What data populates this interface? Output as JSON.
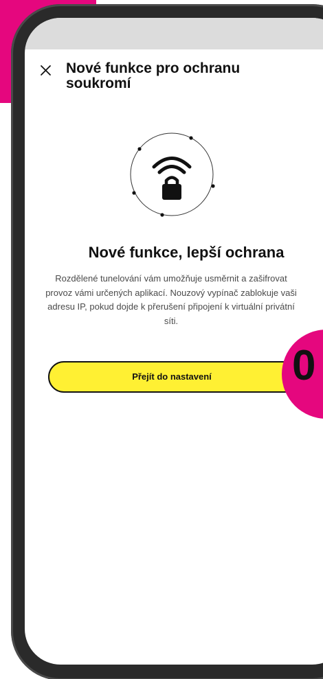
{
  "dialog": {
    "close_label": "×",
    "title": "Nové funkce pro ochranu soukromí"
  },
  "content": {
    "heading": "Nové funkce, lepší ochrana",
    "body": "Rozdělené tunelování vám umožňuje usměrnit a zašifrovat provoz vámi určených aplikací. Nouzový vypínač zablokuje vaši adresu IP, pokud dojde k přerušení připojení k virtuální privátní síti."
  },
  "actions": {
    "cta_label": "Přejít do nastavení"
  },
  "badge": {
    "text": "0"
  },
  "icons": {
    "close": "close-icon",
    "hero": "wifi-lock-icon"
  },
  "colors": {
    "accent_pink": "#e5077e",
    "cta_yellow": "#fff033",
    "text_dark": "#111111",
    "text_muted": "#4a4a4a",
    "frame": "#2a2a2a"
  }
}
